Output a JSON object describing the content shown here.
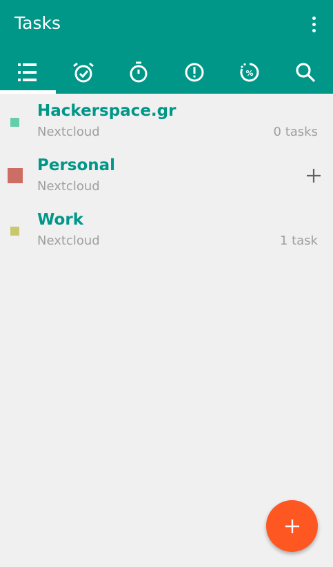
{
  "app": {
    "title": "Tasks"
  },
  "tabs": [
    {
      "name": "list",
      "icon": "list-icon",
      "active": true
    },
    {
      "name": "alarm",
      "icon": "alarm-check-icon",
      "active": false
    },
    {
      "name": "timer",
      "icon": "stopwatch-icon",
      "active": false
    },
    {
      "name": "priority",
      "icon": "alert-circle-icon",
      "active": false
    },
    {
      "name": "progress",
      "icon": "percent-progress-icon",
      "active": false
    },
    {
      "name": "search",
      "icon": "search-icon",
      "active": false
    }
  ],
  "lists": [
    {
      "name": "Hackerspace.gr",
      "account": "Nextcloud",
      "count": "0 tasks",
      "color": "#66cdaa"
    },
    {
      "name": "Personal",
      "account": "Nextcloud",
      "count": "",
      "color": "#cd6e65"
    },
    {
      "name": "Work",
      "account": "Nextcloud",
      "count": "1 task",
      "color": "#c8c86e"
    }
  ],
  "colors": {
    "primary": "#009688",
    "accent": "#ff5722",
    "background": "#f0f0f0"
  }
}
